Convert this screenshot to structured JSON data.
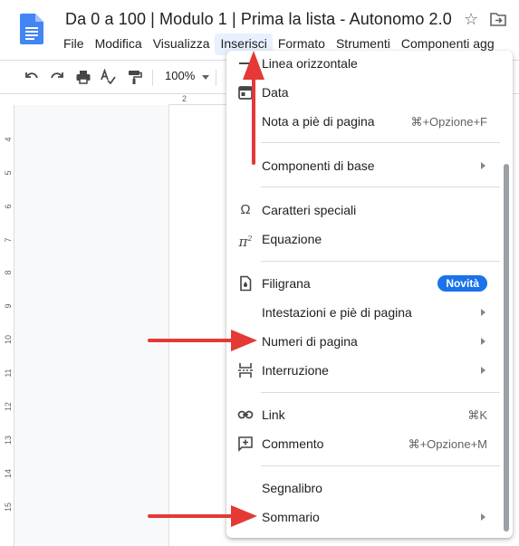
{
  "header": {
    "title": "Da 0 a 100 | Modulo 1 | Prima la lista - Autonomo 2.0",
    "star_icon": "star-outline-icon",
    "move_icon": "move-to-folder-icon"
  },
  "menubar": {
    "items": [
      "File",
      "Modifica",
      "Visualizza",
      "Inserisci",
      "Formato",
      "Strumenti",
      "Componenti agg"
    ],
    "active": "Inserisci"
  },
  "toolbar": {
    "zoom": "100%",
    "icons": [
      "undo-icon",
      "redo-icon",
      "print-icon",
      "spellcheck-icon",
      "paint-format-icon"
    ]
  },
  "ruler": {
    "horizontal_number": "2",
    "vertical_numbers": [
      "4",
      "5",
      "6",
      "7",
      "8",
      "9",
      "10",
      "11",
      "12",
      "13",
      "14",
      "15"
    ]
  },
  "insert_menu": {
    "items": [
      {
        "label": "Linea orizzontale",
        "icon": "horizontal-line-icon"
      },
      {
        "label": "Data",
        "icon": "calendar-icon"
      },
      {
        "label": "Nota a piè di pagina",
        "shortcut": "⌘+Opzione+F"
      },
      {
        "label": "Componenti di base",
        "submenu": true
      },
      {
        "label": "Caratteri speciali",
        "icon": "omega-icon"
      },
      {
        "label": "Equazione",
        "icon": "pi-squared-icon"
      },
      {
        "label": "Filigrana",
        "icon": "watermark-icon",
        "badge": "Novità"
      },
      {
        "label": "Intestazioni e piè di pagina",
        "submenu": true
      },
      {
        "label": "Numeri di pagina",
        "submenu": true
      },
      {
        "label": "Interruzione",
        "icon": "page-break-icon",
        "submenu": true
      },
      {
        "label": "Link",
        "icon": "link-icon",
        "shortcut": "⌘K"
      },
      {
        "label": "Commento",
        "icon": "add-comment-icon",
        "shortcut": "⌘+Opzione+M"
      },
      {
        "label": "Segnalibro"
      },
      {
        "label": "Sommario",
        "submenu": true
      }
    ],
    "badge_color": "#1a73e8"
  },
  "annotations": {
    "arrow_color": "#e53935"
  }
}
